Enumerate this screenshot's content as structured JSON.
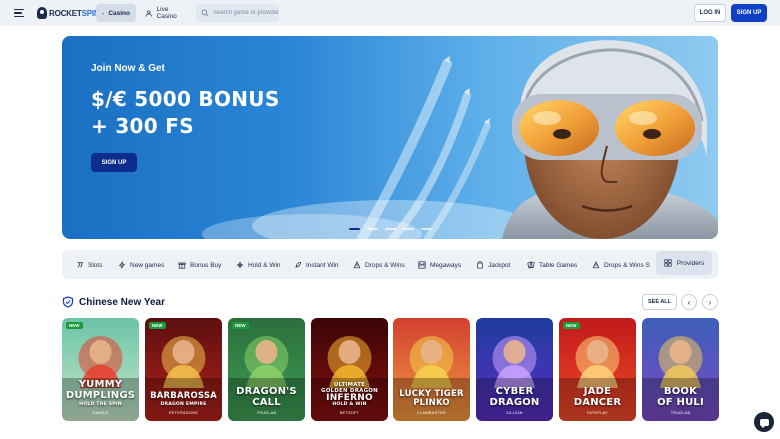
{
  "header": {
    "logo": {
      "part1": "ROCKET",
      "part2": "SPIN"
    },
    "tabs": [
      {
        "label": "Casino",
        "icon": "spade-icon",
        "active": true
      },
      {
        "label": "Live Casino",
        "icon": "dealer-icon",
        "active": false
      }
    ],
    "search_placeholder": "Search game or provider",
    "login_label": "LOG IN",
    "signup_label": "SIGN UP"
  },
  "hero": {
    "kicker": "Join Now & Get",
    "title_line1": "$/€ 5000 BONUS",
    "title_line2": "+ 300 FS",
    "cta_label": "SIGN UP",
    "slides": 5,
    "active_slide": 1
  },
  "categories": [
    {
      "label": "Slots",
      "icon": "slots-icon"
    },
    {
      "label": "New games",
      "icon": "lightning-icon"
    },
    {
      "label": "Bonus Buy",
      "icon": "gift-icon"
    },
    {
      "label": "Hold & Win",
      "icon": "hold-win-icon"
    },
    {
      "label": "Instant Win",
      "icon": "rocket-icon"
    },
    {
      "label": "Drops & Wins",
      "icon": "drops-icon"
    },
    {
      "label": "Megaways",
      "icon": "megaways-icon"
    },
    {
      "label": "Jackpot",
      "icon": "jackpot-icon"
    },
    {
      "label": "Table Games",
      "icon": "cards-icon"
    },
    {
      "label": "Drops & Wins S",
      "icon": "drops-icon"
    }
  ],
  "providers_label": "Providers",
  "section": {
    "title": "Chinese New Year",
    "see_all_label": "SEE ALL",
    "games": [
      {
        "title_lines": [
          "YUMMY",
          "DUMPLINGS"
        ],
        "subtitle": "HOLD THE SPIN",
        "provider": "GAMZIX",
        "new": true,
        "bg_top": "#6cc4a8",
        "bg_bottom": "#c6e6c8",
        "accent": "#e8402e"
      },
      {
        "title_lines": [
          "BARBAROSSA"
        ],
        "subtitle": "DRAGON EMPIRE",
        "provider": "PETER&SONS",
        "new": true,
        "bg_top": "#5c0f10",
        "bg_bottom": "#b5221a",
        "accent": "#f2c14e"
      },
      {
        "title_lines": [
          "DRAGON'S",
          "CALL"
        ],
        "subtitle": "",
        "provider": "TRUELAB",
        "new": true,
        "bg_top": "#2b6e3c",
        "bg_bottom": "#3e9e54",
        "accent": "#8bd16a"
      },
      {
        "title_lines": [
          "ULTIMATE",
          "GOLDEN DRAGON",
          "INFERNO"
        ],
        "subtitle": "HOLD & WIN",
        "provider": "BETSOFT",
        "new": false,
        "bg_top": "#3a0606",
        "bg_bottom": "#8a0f0f",
        "accent": "#f5b52e"
      },
      {
        "title_lines": [
          "LUCKY TIGER",
          "PLINKO"
        ],
        "subtitle": "",
        "provider": "CLAWBUSTER",
        "new": false,
        "bg_top": "#d24030",
        "bg_bottom": "#f29a3e",
        "accent": "#f6d04d"
      },
      {
        "title_lines": [
          "CYBER",
          "DRAGON"
        ],
        "subtitle": "",
        "provider": "ZILLION",
        "new": false,
        "bg_top": "#1e3d9e",
        "bg_bottom": "#5b2dc4",
        "accent": "#c8a2ff"
      },
      {
        "title_lines": [
          "JADE",
          "DANCER"
        ],
        "subtitle": "",
        "provider": "FATEPLAY",
        "new": true,
        "bg_top": "#c11a1a",
        "bg_bottom": "#ef4a2a",
        "accent": "#ffd27a"
      },
      {
        "title_lines": [
          "BOOK",
          "OF HULI"
        ],
        "subtitle": "",
        "provider": "TRUELAB",
        "new": false,
        "bg_top": "#3d5fb8",
        "bg_bottom": "#7a4ac4",
        "accent": "#f0c85a"
      }
    ]
  },
  "colors": {
    "brand_blue": "#1040c8",
    "dark_navy": "#0d2d8c",
    "new_badge": "#1a9a3a"
  }
}
